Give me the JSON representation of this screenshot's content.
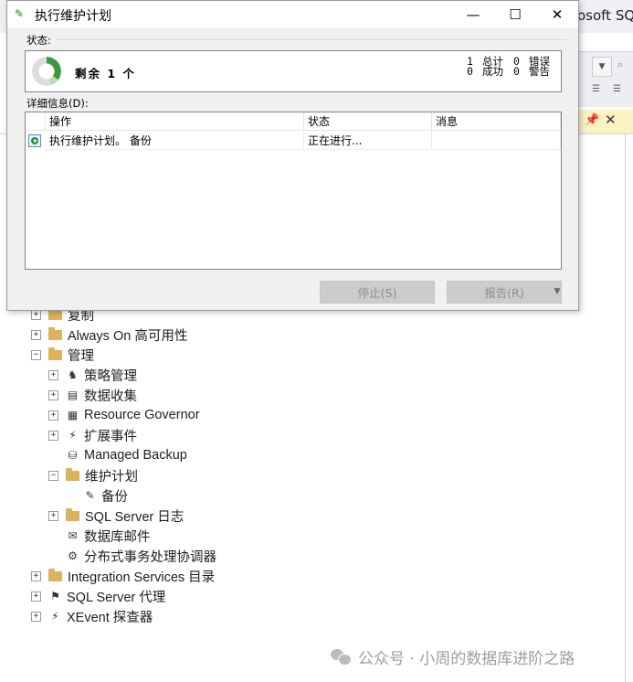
{
  "background_window": {
    "title_fragment": "osoft SQ"
  },
  "tree": [
    {
      "label": "复制",
      "level": 0,
      "expander": "+",
      "icon": "folder-icon"
    },
    {
      "label": "Always On 高可用性",
      "level": 0,
      "expander": "+",
      "icon": "folder-icon"
    },
    {
      "label": "管理",
      "level": 0,
      "expander": "-",
      "icon": "folder-icon"
    },
    {
      "label": "策略管理",
      "level": 1,
      "expander": "+",
      "icon": "policy-icon"
    },
    {
      "label": "数据收集",
      "level": 1,
      "expander": "+",
      "icon": "data-collection-icon"
    },
    {
      "label": "Resource Governor",
      "level": 1,
      "expander": "+",
      "icon": "resource-governor-icon"
    },
    {
      "label": "扩展事件",
      "level": 1,
      "expander": "+",
      "icon": "extended-events-icon"
    },
    {
      "label": "Managed Backup",
      "level": 1,
      "expander": "",
      "icon": "managed-backup-icon"
    },
    {
      "label": "维护计划",
      "level": 1,
      "expander": "-",
      "icon": "folder-icon"
    },
    {
      "label": "备份",
      "level": 2,
      "expander": "",
      "icon": "maintenance-plan-icon"
    },
    {
      "label": "SQL Server 日志",
      "level": 1,
      "expander": "+",
      "icon": "folder-icon"
    },
    {
      "label": "数据库邮件",
      "level": 1,
      "expander": "",
      "icon": "database-mail-icon"
    },
    {
      "label": "分布式事务处理协调器",
      "level": 1,
      "expander": "",
      "icon": "dtc-icon"
    },
    {
      "label": "Integration Services 目录",
      "level": 0,
      "expander": "+",
      "icon": "folder-icon"
    },
    {
      "label": "SQL Server 代理",
      "level": 0,
      "expander": "+",
      "icon": "sql-agent-icon"
    },
    {
      "label": "XEvent 探查器",
      "level": 0,
      "expander": "+",
      "icon": "xevent-profiler-icon"
    }
  ],
  "dialog": {
    "title": "执行维护计划",
    "status_label": "状态:",
    "remaining_text": "剩余 1 个",
    "progress_fraction": 0.35,
    "counts": {
      "total_value": "1",
      "total_label": "总计",
      "error_value": "0",
      "error_label": "错误",
      "success_value": "0",
      "success_label": "成功",
      "warning_value": "0",
      "warning_label": "警告"
    },
    "details_label": "详细信息(D):",
    "columns": [
      "操作",
      "状态",
      "消息"
    ],
    "rows": [
      {
        "action": "执行维护计划。 备份",
        "status": "正在进行...",
        "message": ""
      }
    ],
    "stop_button": "停止(S)",
    "report_button": "报告(R)"
  },
  "watermark": "公众号 · 小周的数据库进阶之路"
}
